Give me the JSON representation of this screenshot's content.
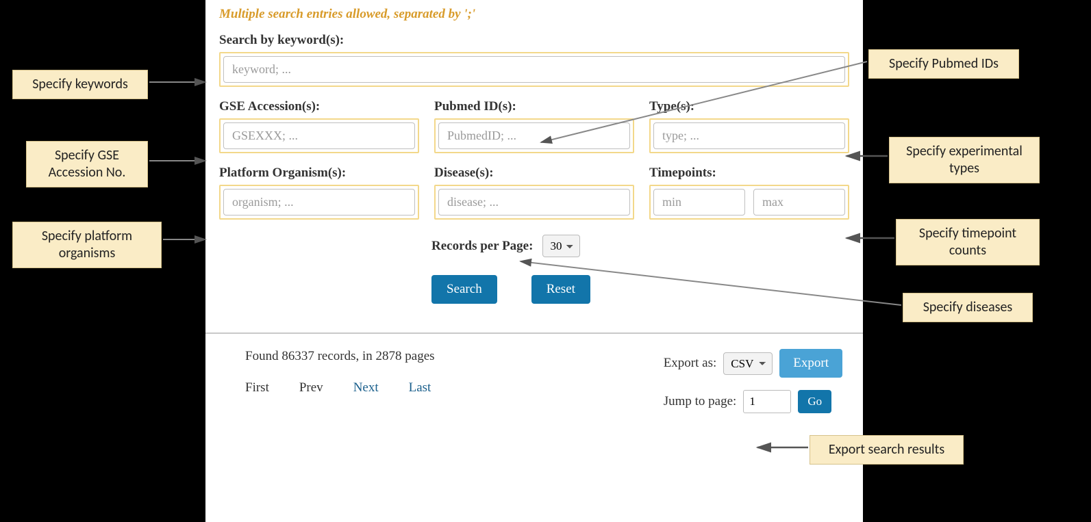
{
  "form": {
    "hint": "Multiple search entries allowed, separated by ';'",
    "keyword": {
      "label": "Search by keyword(s):",
      "placeholder": "keyword; ..."
    },
    "gse": {
      "label": "GSE Accession(s):",
      "placeholder": "GSEXXX; ..."
    },
    "pubmed": {
      "label": "Pubmed ID(s):",
      "placeholder": "PubmedID; ..."
    },
    "type": {
      "label": "Type(s):",
      "placeholder": "type; ..."
    },
    "organism": {
      "label": "Platform Organism(s):",
      "placeholder": "organism; ..."
    },
    "disease": {
      "label": "Disease(s):",
      "placeholder": "disease; ..."
    },
    "timepoints": {
      "label": "Timepoints:",
      "min_placeholder": "min",
      "max_placeholder": "max"
    },
    "rpp": {
      "label": "Records per Page:",
      "value": "30"
    },
    "search_btn": "Search",
    "reset_btn": "Reset"
  },
  "results": {
    "status": "Found 86337 records, in 2878 pages",
    "pager": {
      "first": "First",
      "prev": "Prev",
      "next": "Next",
      "last": "Last"
    },
    "export_label": "Export as:",
    "export_format": "CSV",
    "export_btn": "Export",
    "jump_label": "Jump to page:",
    "jump_value": "1",
    "go_btn": "Go"
  },
  "callouts": {
    "keywords": "Specify keywords",
    "gse": "Specify GSE Accession No.",
    "organisms": "Specify platform organisms",
    "pubmed": "Specify Pubmed IDs",
    "types": "Specify experimental types",
    "timepoints": "Specify timepoint counts",
    "diseases": "Specify diseases",
    "export": "Export search results"
  }
}
